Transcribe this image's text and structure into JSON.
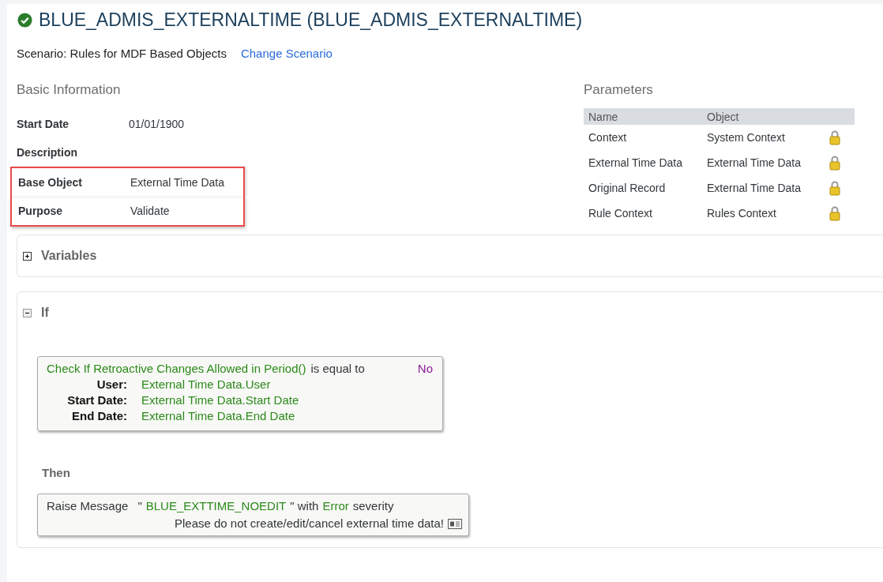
{
  "title": {
    "text": "BLUE_ADMIS_EXTERNALTIME (BLUE_ADMIS_EXTERNALTIME)"
  },
  "scenario": {
    "label": "Scenario: Rules for MDF Based Objects",
    "link": "Change Scenario"
  },
  "basic_info": {
    "heading": "Basic Information",
    "fields": [
      {
        "label": "Start Date",
        "value": "01/01/1900",
        "highlighted": false
      },
      {
        "label": "Description",
        "highlighted": false
      },
      {
        "label": "Base Object",
        "value": "External Time Data",
        "highlighted": true
      },
      {
        "label": "Purpose",
        "value": "Validate",
        "highlighted": true
      }
    ]
  },
  "parameters": {
    "heading": "Parameters",
    "columns": [
      "Name",
      "Object"
    ],
    "rows": [
      {
        "name": "Context",
        "object": "System Context",
        "locked": true
      },
      {
        "name": "External Time Data",
        "object": "External Time Data",
        "locked": true
      },
      {
        "name": "Original Record",
        "object": "External Time Data",
        "locked": true
      },
      {
        "name": "Rule Context",
        "object": "Rules Context",
        "locked": true
      }
    ]
  },
  "variables": {
    "title": "Variables",
    "expanded": false
  },
  "if_section": {
    "title": "If",
    "expanded": true,
    "condition": {
      "function": "Check If Retroactive Changes Allowed in Period()",
      "operator": "is equal to",
      "value": "No",
      "args": [
        {
          "label": "User:",
          "value": "External Time Data.User"
        },
        {
          "label": "Start Date:",
          "value": "External Time Data.Start Date"
        },
        {
          "label": "End Date:",
          "value": "External Time Data.End Date"
        }
      ]
    },
    "then_label": "Then",
    "action": {
      "verb": "Raise Message",
      "open_quote": "\"",
      "message_key": "BLUE_EXTTIME_NOEDIT",
      "close_text": "\" with",
      "severity": "Error",
      "suffix": "severity",
      "message_text": "Please do not create/edit/cancel external time data!"
    }
  }
}
